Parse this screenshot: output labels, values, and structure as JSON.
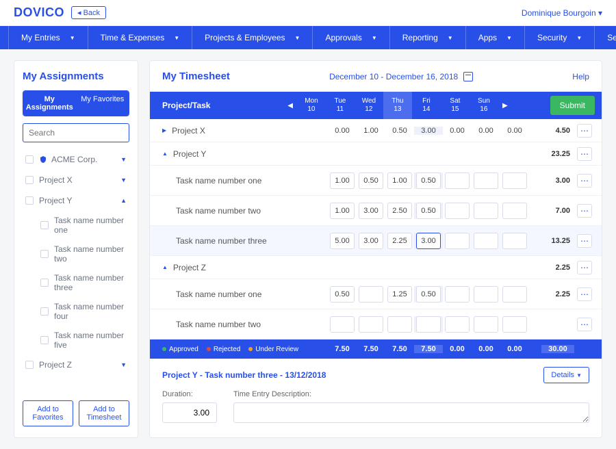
{
  "brand": "DOVICO",
  "back_label": "Back",
  "user_name": "Dominique Bourgoin",
  "nav": [
    "My Entries",
    "Time & Expenses",
    "Projects & Employees",
    "Approvals",
    "Reporting",
    "Apps",
    "Security",
    "Setup"
  ],
  "sidebar": {
    "title": "My Assignments",
    "tabs": {
      "assignments": "My Assignments",
      "favorites": "My Favorites"
    },
    "search_placeholder": "Search",
    "tree": {
      "acme": "ACME Corp.",
      "project_x": "Project X",
      "project_y": "Project Y",
      "py_tasks": [
        "Task name number one",
        "Task name number two",
        "Task name number three",
        "Task name number four",
        "Task name number five"
      ],
      "project_z": "Project Z"
    },
    "actions": {
      "fav": "Add to Favorites",
      "ts": "Add to Timesheet"
    }
  },
  "timesheet": {
    "title": "My Timesheet",
    "range": "December 10 - December 16, 2018",
    "help": "Help",
    "header_pt": "Project/Task",
    "days": [
      {
        "d": "Mon",
        "n": "10"
      },
      {
        "d": "Tue",
        "n": "11"
      },
      {
        "d": "Wed",
        "n": "12"
      },
      {
        "d": "Thu",
        "n": "13"
      },
      {
        "d": "Fri",
        "n": "14"
      },
      {
        "d": "Sat",
        "n": "15"
      },
      {
        "d": "Sun",
        "n": "16"
      }
    ],
    "submit": "Submit",
    "rows": {
      "px": {
        "name": "Project X",
        "vals": [
          "0.00",
          "1.00",
          "0.50",
          "3.00",
          "0.00",
          "0.00",
          "0.00"
        ],
        "tot": "4.50"
      },
      "py": {
        "name": "Project Y",
        "tot": "23.25"
      },
      "py1": {
        "name": "Task name number one",
        "vals": [
          "1.00",
          "0.50",
          "1.00",
          "0.50",
          "",
          "",
          ""
        ],
        "tot": "3.00"
      },
      "py2": {
        "name": "Task name number two",
        "vals": [
          "1.00",
          "3.00",
          "2.50",
          "0.50",
          "",
          "",
          ""
        ],
        "tot": "7.00"
      },
      "py3": {
        "name": "Task name number three",
        "vals": [
          "5.00",
          "3.00",
          "2.25",
          "3.00",
          "",
          "",
          ""
        ],
        "tot": "13.25"
      },
      "pz": {
        "name": "Project Z",
        "tot": "2.25"
      },
      "pz1": {
        "name": "Task name number one",
        "vals": [
          "0.50",
          "",
          "1.25",
          "0.50",
          "",
          "",
          ""
        ],
        "tot": "2.25"
      },
      "pz2": {
        "name": "Task name number two",
        "vals": [
          "",
          "",
          "",
          "",
          "",
          "",
          ""
        ],
        "tot": ""
      }
    },
    "legend": {
      "approved": "Approved",
      "rejected": "Rejected",
      "review": "Under Review"
    },
    "totals": [
      "7.50",
      "7.50",
      "7.50",
      "7.50",
      "0.00",
      "0.00",
      "0.00"
    ],
    "grand": "30.00"
  },
  "detail": {
    "title": "Project Y - Task number three - 13/12/2018",
    "btn": "Details",
    "dur_label": "Duration:",
    "dur_value": "3.00",
    "desc_label": "Time Entry Description:"
  }
}
